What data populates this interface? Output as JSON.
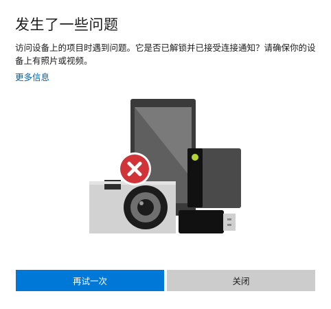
{
  "dialog": {
    "title": "发生了一些问题",
    "message": "访问设备上的项目时遇到问题。它是否已解锁并已接受连接通知？请确保你的设备上有照片或视频。",
    "more_info_link": "更多信息",
    "retry_button": "再试一次",
    "close_button": "关闭"
  },
  "colors": {
    "accent": "#0078d7",
    "link": "#0063b1",
    "error": "#d13438",
    "secondary_button": "#cccccc"
  },
  "icons": {
    "illustration": "devices-error-illustration",
    "error": "error-x-icon"
  }
}
